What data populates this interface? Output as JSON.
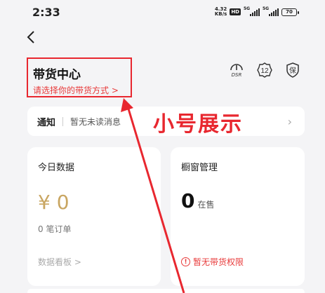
{
  "status_bar": {
    "time": "2:33",
    "net_speed_value": "4.32",
    "net_speed_unit": "KB/s",
    "hd": "HD",
    "signal1": "5G",
    "signal2": "5G",
    "battery": "70"
  },
  "header": {
    "back_icon": "chevron-left-icon",
    "title": "带货中心",
    "subtitle": "请选择你的带货方式 >",
    "icons": [
      "dsr-gauge-icon",
      "badge-12-icon",
      "shield-guarantee-icon"
    ],
    "dsr_label": "DSR",
    "badge_number": "12",
    "shield_char": "保"
  },
  "notice": {
    "label": "通知",
    "text": "暂无未读消息",
    "arrow": "›"
  },
  "annotation": {
    "caption": "小号展示",
    "color": "#e8272f"
  },
  "today_data": {
    "title": "今日数据",
    "amount": "¥ 0",
    "orders": "0 笔订单",
    "board_link": "数据看板 >"
  },
  "window_mgmt": {
    "title": "橱窗管理",
    "count": "0",
    "count_label": "在售",
    "no_permission": "暂无带货权限"
  },
  "colors": {
    "accent_red": "#e83a3a",
    "gold": "#c9a662",
    "background": "#f4f4f6"
  }
}
